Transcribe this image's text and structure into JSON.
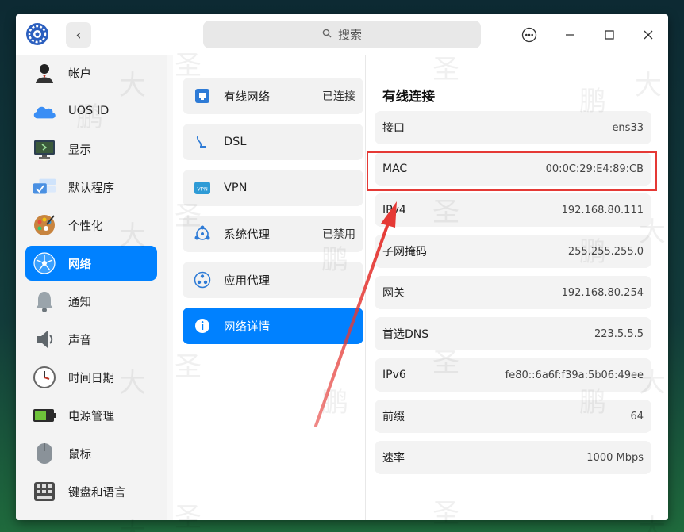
{
  "search": {
    "placeholder": "搜索"
  },
  "sidebar": {
    "items": [
      {
        "label": "帐户",
        "icon": "user-account-icon"
      },
      {
        "label": "UOS ID",
        "icon": "cloud-icon"
      },
      {
        "label": "显示",
        "icon": "display-icon"
      },
      {
        "label": "默认程序",
        "icon": "default-apps-icon"
      },
      {
        "label": "个性化",
        "icon": "palette-icon"
      },
      {
        "label": "网络",
        "icon": "network-icon",
        "active": true
      },
      {
        "label": "通知",
        "icon": "bell-icon"
      },
      {
        "label": "声音",
        "icon": "speaker-icon"
      },
      {
        "label": "时间日期",
        "icon": "clock-icon"
      },
      {
        "label": "电源管理",
        "icon": "battery-icon"
      },
      {
        "label": "鼠标",
        "icon": "mouse-icon"
      },
      {
        "label": "键盘和语言",
        "icon": "keyboard-icon"
      }
    ]
  },
  "network": {
    "items": [
      {
        "label": "有线网络",
        "status": "已连接",
        "icon": "ethernet-icon"
      },
      {
        "label": "DSL",
        "status": "",
        "icon": "dsl-icon"
      },
      {
        "label": "VPN",
        "status": "",
        "icon": "vpn-icon"
      },
      {
        "label": "系统代理",
        "status": "已禁用",
        "icon": "system-proxy-icon"
      },
      {
        "label": "应用代理",
        "status": "",
        "icon": "app-proxy-icon"
      },
      {
        "label": "网络详情",
        "status": "",
        "icon": "info-icon",
        "active": true
      }
    ]
  },
  "details": {
    "title": "有线连接",
    "rows": [
      {
        "key": "接口",
        "value": "ens33"
      },
      {
        "key": "MAC",
        "value": "00:0C:29:E4:89:CB"
      },
      {
        "key": "IPv4",
        "value": "192.168.80.111"
      },
      {
        "key": "子网掩码",
        "value": "255.255.255.0"
      },
      {
        "key": "网关",
        "value": "192.168.80.254"
      },
      {
        "key": "首选DNS",
        "value": "223.5.5.5"
      },
      {
        "key": "IPv6",
        "value": "fe80::6a6f:f39a:5b06:49ee"
      },
      {
        "key": "前缀",
        "value": "64"
      },
      {
        "key": "速率",
        "value": "1000 Mbps"
      }
    ]
  },
  "colors": {
    "accent": "#0081ff",
    "highlight": "#e53935"
  }
}
